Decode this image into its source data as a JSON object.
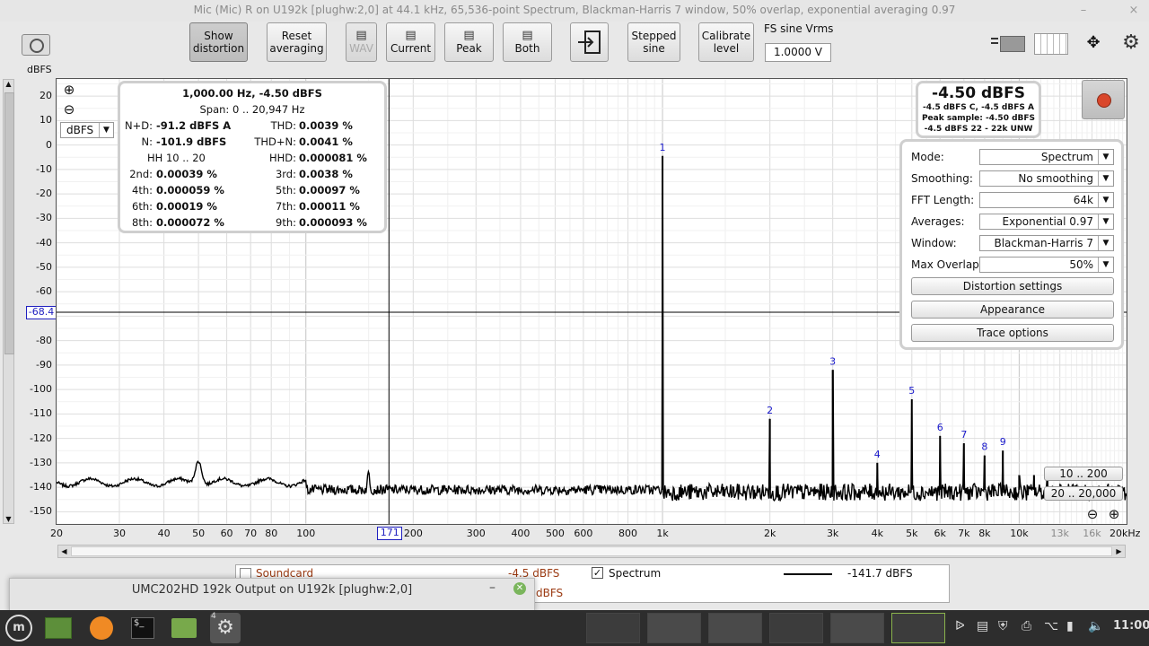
{
  "window": {
    "title": "Mic (Mic) R on U192k [plughw:2,0] at 44.1 kHz, 65,536-point Spectrum, Blackman-Harris 7 window, 50% overlap, exponential averaging 0.97",
    "min": "–",
    "close": "×"
  },
  "toolbar": {
    "show_distortion": [
      "Show",
      "distortion"
    ],
    "reset_averaging": [
      "Reset",
      "averaging"
    ],
    "wav": "WAV",
    "current": "Current",
    "peak": "Peak",
    "both": "Both",
    "stepped_sine": [
      "Stepped",
      "sine"
    ],
    "calibrate_level": [
      "Calibrate",
      "level"
    ],
    "fs_label": "FS sine Vrms",
    "fs_value": "1.0000 V"
  },
  "plot": {
    "y_unit": "dBFS",
    "unit_select": "dBFS",
    "y_ticks": [
      "20",
      "10",
      "0",
      "-10",
      "-20",
      "-30",
      "-40",
      "-50",
      "-60",
      "-70",
      "-80",
      "-90",
      "-100",
      "-110",
      "-120",
      "-130",
      "-140",
      "-150"
    ],
    "x_ticks": [
      {
        "label": "20",
        "f": 20
      },
      {
        "label": "30",
        "f": 30
      },
      {
        "label": "40",
        "f": 40
      },
      {
        "label": "50",
        "f": 50
      },
      {
        "label": "60",
        "f": 60
      },
      {
        "label": "70",
        "f": 70
      },
      {
        "label": "80",
        "f": 80
      },
      {
        "label": "100",
        "f": 100
      },
      {
        "label": "200",
        "f": 200
      },
      {
        "label": "300",
        "f": 300
      },
      {
        "label": "400",
        "f": 400
      },
      {
        "label": "500",
        "f": 500
      },
      {
        "label": "600",
        "f": 600
      },
      {
        "label": "800",
        "f": 800
      },
      {
        "label": "1k",
        "f": 1000
      },
      {
        "label": "2k",
        "f": 2000
      },
      {
        "label": "3k",
        "f": 3000
      },
      {
        "label": "4k",
        "f": 4000
      },
      {
        "label": "5k",
        "f": 5000
      },
      {
        "label": "6k",
        "f": 6000
      },
      {
        "label": "7k",
        "f": 7000
      },
      {
        "label": "8k",
        "f": 8000
      },
      {
        "label": "10k",
        "f": 10000
      }
    ],
    "x_ticks_dim": [
      {
        "label": "13k",
        "f": 13000
      },
      {
        "label": "16k",
        "f": 16000
      }
    ],
    "x_last_label": "20kHz",
    "cursor_x": "171",
    "cursor_x_hz": 171,
    "cursor_y": "-68.4",
    "cursor_y_db": -68.4,
    "harmonics": [
      {
        "n": "1",
        "f": 1000,
        "db": -4.5
      },
      {
        "n": "2",
        "f": 2000,
        "db": -112
      },
      {
        "n": "3",
        "f": 3000,
        "db": -92
      },
      {
        "n": "4",
        "f": 4000,
        "db": -130
      },
      {
        "n": "5",
        "f": 5000,
        "db": -104
      },
      {
        "n": "6",
        "f": 6000,
        "db": -119
      },
      {
        "n": "7",
        "f": 7000,
        "db": -122
      },
      {
        "n": "8",
        "f": 8000,
        "db": -127
      },
      {
        "n": "9",
        "f": 9000,
        "db": -125
      }
    ],
    "range_a": "10 .. 200",
    "range_b": "20 .. 20,000",
    "zoom_in": "⊕",
    "zoom_out": "⊖"
  },
  "distortion": {
    "header": "1,000.00 Hz, -4.50 dBFS",
    "span": "Span:  0 .. 20,947 Hz",
    "rows": [
      {
        "l1": "N+D:",
        "v1": "-91.2 dBFS A",
        "l2": "THD:",
        "v2": "0.0039 %"
      },
      {
        "l1": "N:",
        "v1": "-101.9 dBFS",
        "l2": "THD+N:",
        "v2": "0.0041 %"
      },
      {
        "l1": "HH 10 .. 20",
        "v1": "",
        "l2": "HHD:",
        "v2": "0.000081 %"
      },
      {
        "l1": "2nd:",
        "v1": "0.00039 %",
        "l2": "3rd:",
        "v2": "0.0038 %"
      },
      {
        "l1": "4th:",
        "v1": "0.000059 %",
        "l2": "5th:",
        "v2": "0.00097 %"
      },
      {
        "l1": "6th:",
        "v1": "0.00019 %",
        "l2": "7th:",
        "v2": "0.00011 %"
      },
      {
        "l1": "8th:",
        "v1": "0.000072 %",
        "l2": "9th:",
        "v2": "0.000093 %"
      }
    ]
  },
  "level": {
    "big": "-4.50 dBFS",
    "l1": "-4.5 dBFS C, -4.5 dBFS A",
    "l2": "Peak sample: -4.50 dBFS",
    "l3": "-4.5 dBFS 22 - 22k UNW"
  },
  "settings": {
    "mode_label": "Mode:",
    "mode": "Spectrum",
    "smoothing_label": "Smoothing:",
    "smoothing": "No  smoothing",
    "fft_label": "FFT Length:",
    "fft": "64k",
    "avg_label": "Averages:",
    "avg": "Exponential 0.97",
    "window_label": "Window:",
    "window": "Blackman-Harris 7",
    "overlap_label": "Max Overlap:",
    "overlap": "50%",
    "btn_distortion": "Distortion settings",
    "btn_appearance": "Appearance",
    "btn_trace": "Trace options"
  },
  "legend": {
    "soundcard": "Soundcard",
    "soundcard_val": "-4.5 dBFS",
    "spectrum": "Spectrum",
    "spectrum_val": "-141.7 dBFS",
    "hidden_val": "dBFS"
  },
  "popup": {
    "title": "UMC202HD 192k Output on U192k [plughw:2,0]",
    "min": "–",
    "close": "✕"
  },
  "taskbar": {
    "badge": "4",
    "time": "11:00"
  },
  "colors": {
    "harmonic_label": "#1a1acc",
    "trace": "#000000",
    "record": "#d9472b"
  }
}
